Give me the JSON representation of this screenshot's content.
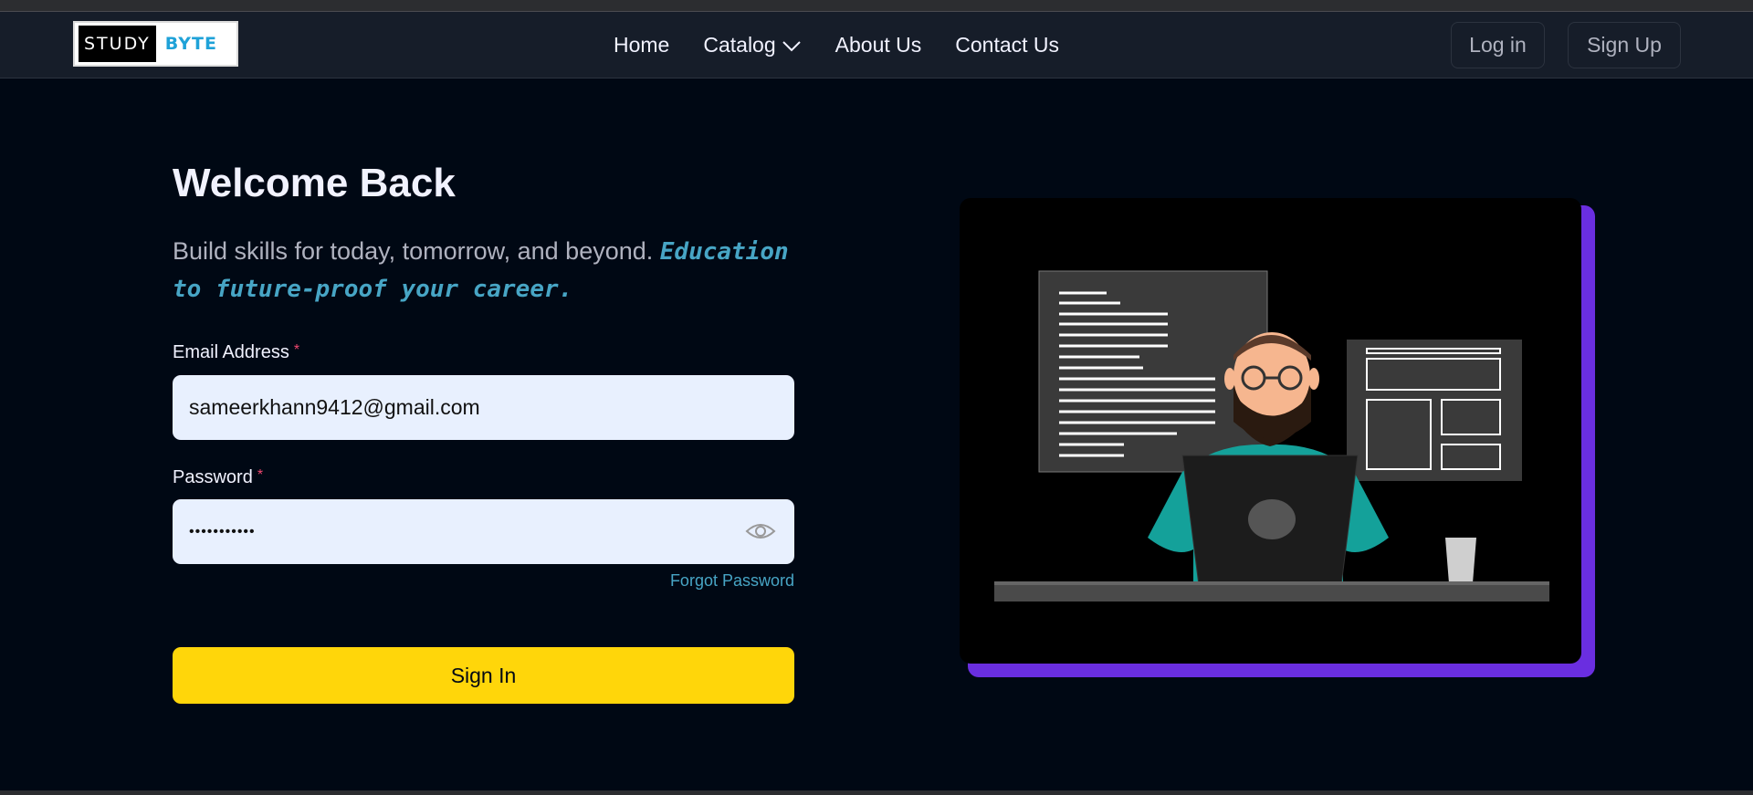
{
  "brand": {
    "left": "STUDY",
    "right": "BYTE"
  },
  "nav": {
    "links": [
      {
        "label": "Home"
      },
      {
        "label": "Catalog",
        "icon": "chevron-down-icon"
      },
      {
        "label": "About Us"
      },
      {
        "label": "Contact Us"
      }
    ],
    "login_label": "Log in",
    "signup_label": "Sign Up"
  },
  "main": {
    "title": "Welcome Back",
    "subtitle": "Build skills for today, tomorrow, and beyond.",
    "subtitle_accent": "Education to future-proof your career.",
    "email": {
      "label": "Email Address",
      "required_mark": "*",
      "value": "sameerkhann9412@gmail.com"
    },
    "password": {
      "label": "Password",
      "required_mark": "*",
      "value": "•••••••••••",
      "icon": "eye-icon"
    },
    "forgot_label": "Forgot Password",
    "signin_label": "Sign In"
  },
  "colors": {
    "background": "#000814",
    "navbar": "#161d29",
    "accent_yellow": "#ffd60a",
    "accent_blue": "#47a5c5",
    "frame_purple": "#6a2ee0",
    "input_bg": "#e8f0fe"
  }
}
